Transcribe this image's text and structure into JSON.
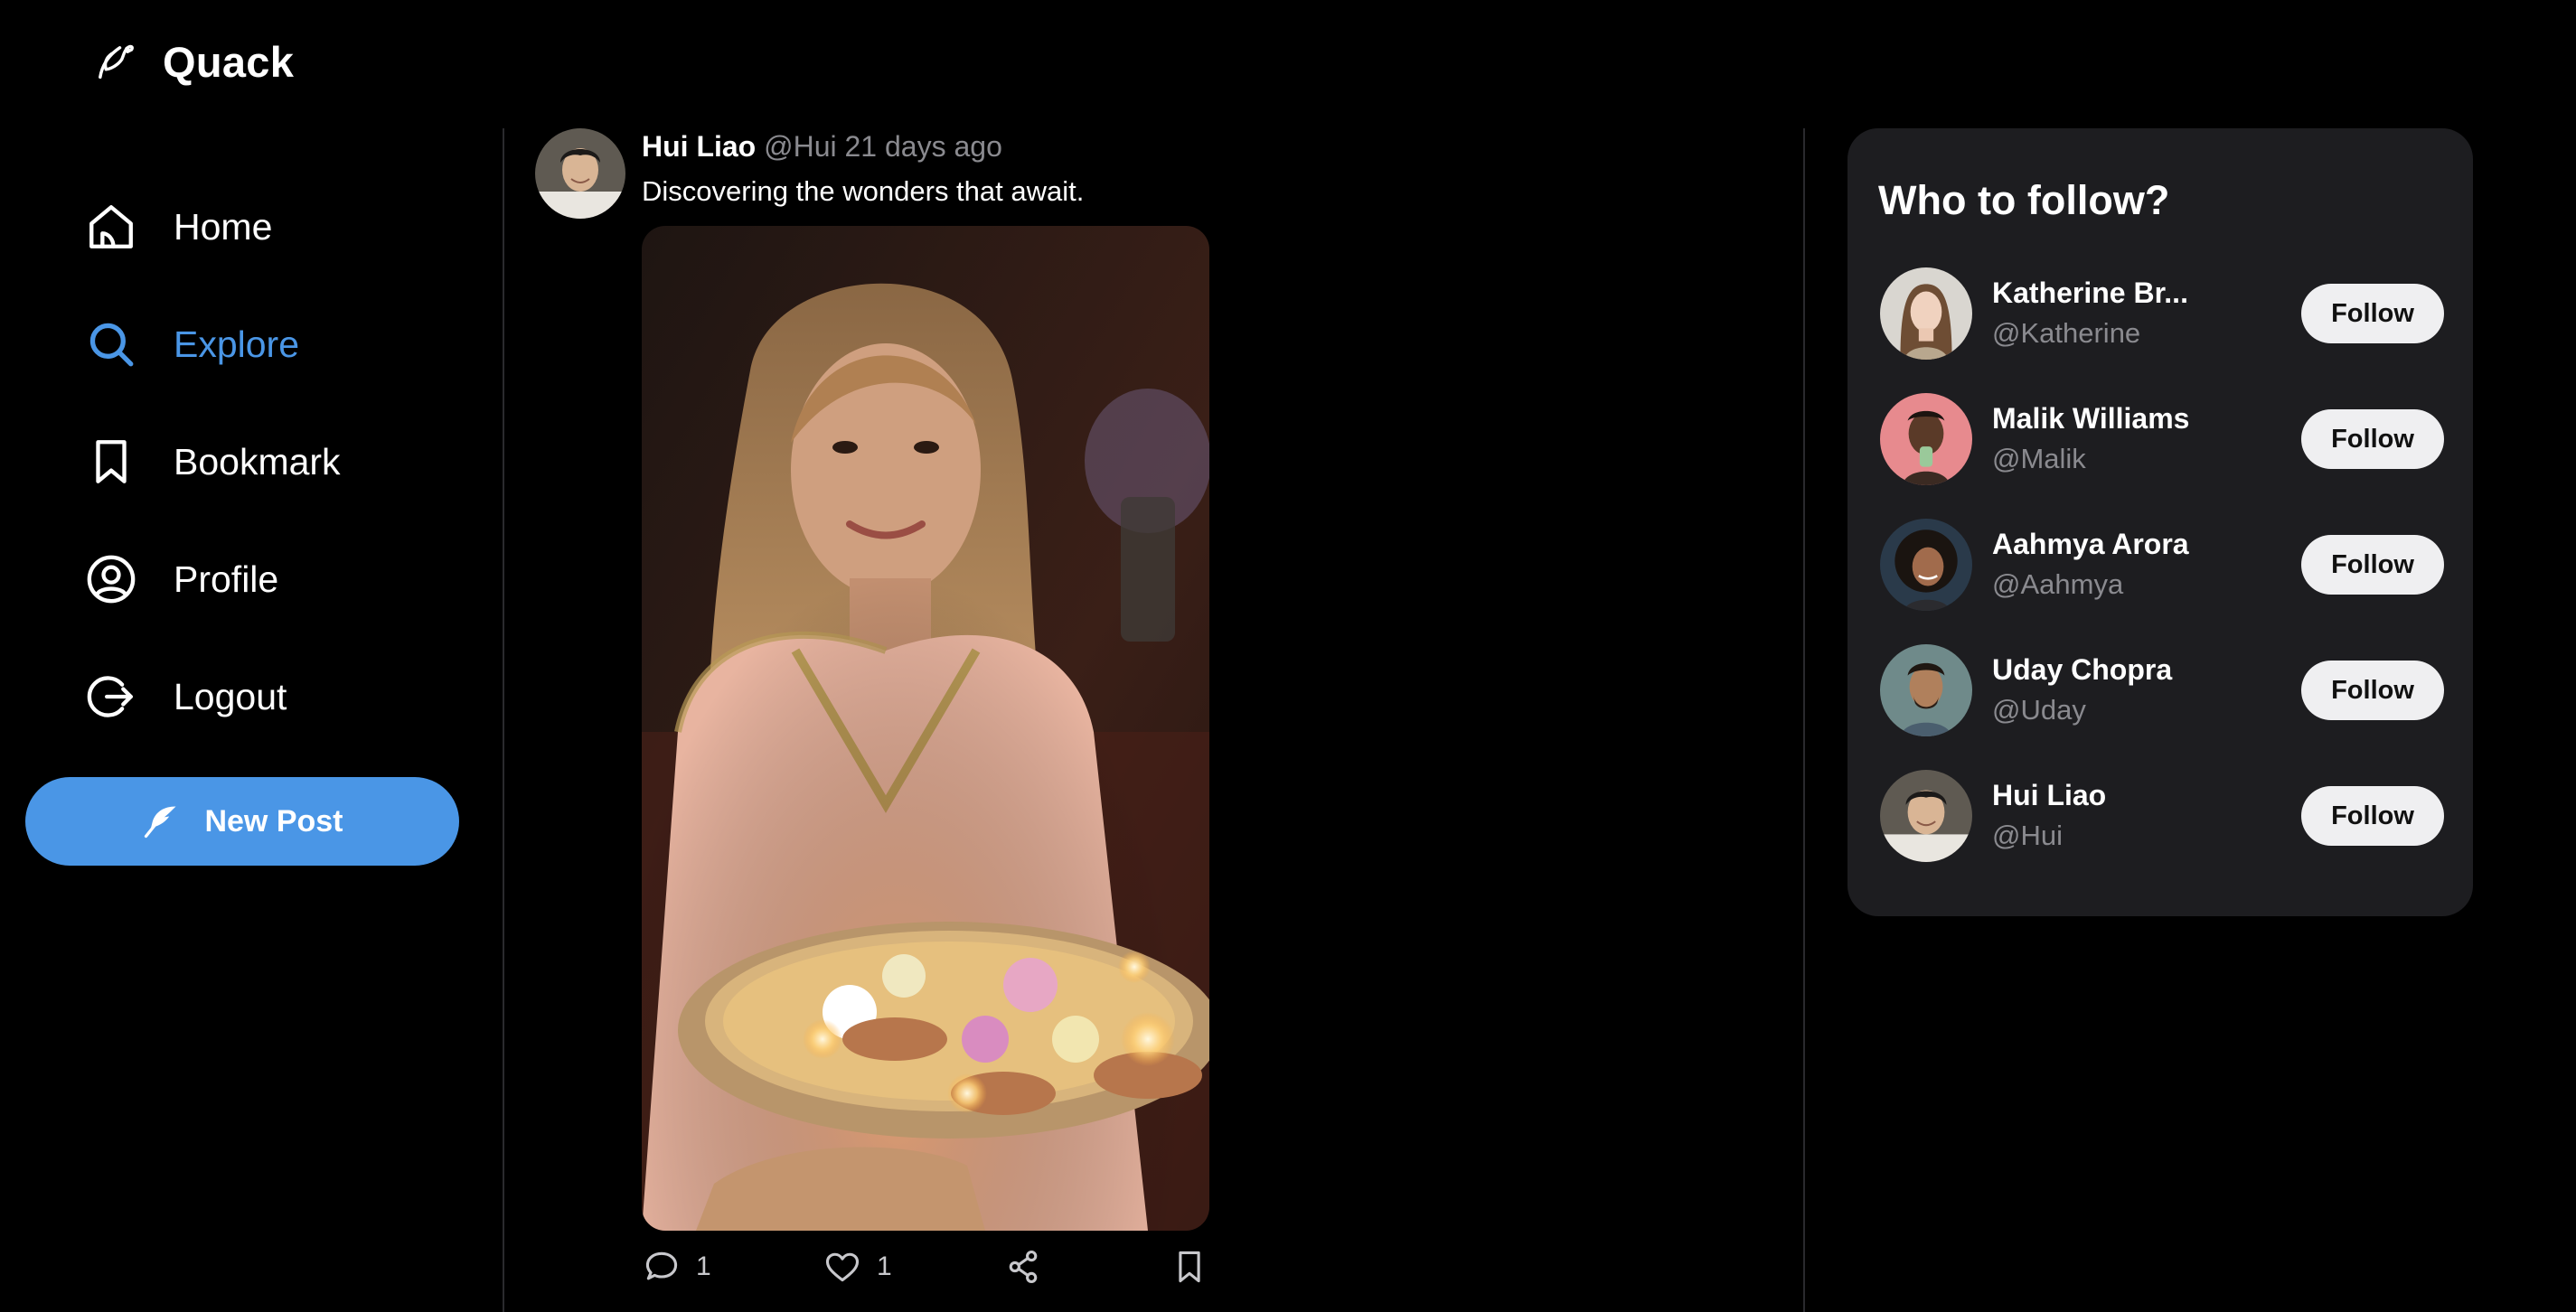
{
  "app": {
    "name": "Quack",
    "logo_icon": "duck-feather-icon",
    "accent": "#4a96e6"
  },
  "nav": [
    {
      "label": "Home",
      "icon": "home-icon",
      "active": false
    },
    {
      "label": "Explore",
      "icon": "search-icon",
      "active": true
    },
    {
      "label": "Bookmark",
      "icon": "bookmark-icon",
      "active": false
    },
    {
      "label": "Profile",
      "icon": "profile-icon",
      "active": false
    },
    {
      "label": "Logout",
      "icon": "logout-icon",
      "active": false
    }
  ],
  "new_post": {
    "label": "New Post",
    "icon": "feather-icon"
  },
  "post": {
    "author": "Hui Liao",
    "handle": "@Hui",
    "time": "21 days ago",
    "text": "Discovering the wonders that await.",
    "comments": "1",
    "likes": "1"
  },
  "who_to_follow": {
    "title": "Who to follow?",
    "button_label": "Follow",
    "users": [
      {
        "name": "Katherine Br...",
        "handle": "@Katherine"
      },
      {
        "name": "Malik Williams",
        "handle": "@Malik"
      },
      {
        "name": "Aahmya Arora",
        "handle": "@Aahmya"
      },
      {
        "name": "Uday Chopra",
        "handle": "@Uday"
      },
      {
        "name": "Hui Liao",
        "handle": "@Hui"
      }
    ]
  }
}
